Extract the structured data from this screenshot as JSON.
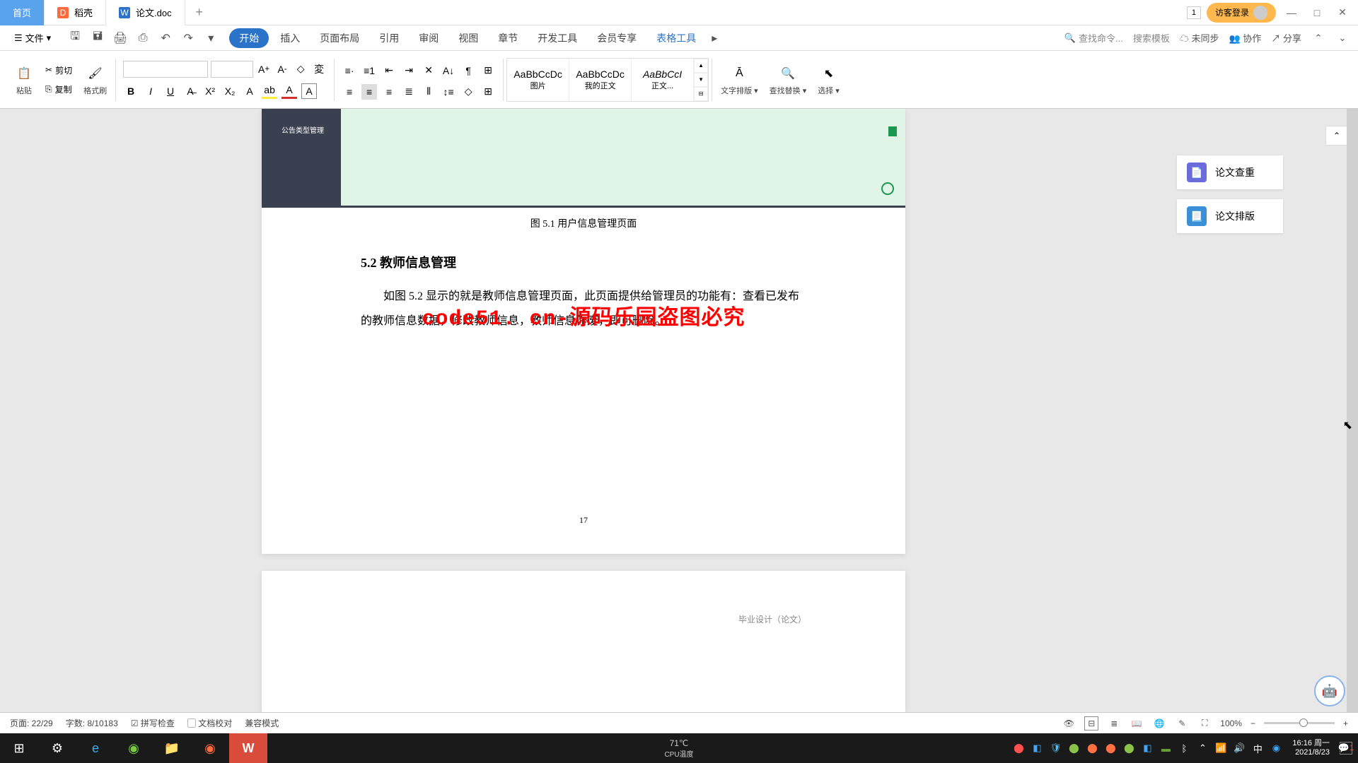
{
  "tabs": {
    "home": "首页",
    "daoke": "稻壳",
    "doc": "论文.doc"
  },
  "title_right": {
    "badge": "1",
    "login": "访客登录"
  },
  "menu": {
    "file": "文件",
    "items": [
      "开始",
      "插入",
      "页面布局",
      "引用",
      "审阅",
      "视图",
      "章节",
      "开发工具",
      "会员专享",
      "表格工具"
    ],
    "search_cmd": "查找命令...",
    "search_tpl": "搜索模板",
    "unsync": "未同步",
    "coop": "协作",
    "share": "分享"
  },
  "ribbon": {
    "paste": "粘贴",
    "cut": "剪切",
    "copy": "复制",
    "format_painter": "格式刷",
    "styles": {
      "s1_preview": "AaBbCcDc",
      "s1_name": "图片",
      "s2_preview": "AaBbCcDc",
      "s2_name": "我的正文",
      "s3_preview": "AaBbCcI",
      "s3_name": "正文..."
    },
    "text_layout": "文字排版",
    "find_replace": "查找替换",
    "select": "选择"
  },
  "document": {
    "embedded_label": "公告类型管理",
    "fig_caption": "图 5.1  用户信息管理页面",
    "heading": "5.2  教师信息管理",
    "paragraph": "如图 5.2 显示的就是教师信息管理页面，此页面提供给管理员的功能有：查看已发布的教师信息数据，修改教师信息，教师信息作废，即可删除。",
    "page_num": "17",
    "page2_header": "毕业设计（论文）",
    "watermark_center": "code51. cn-源码乐园盗图必究",
    "watermark_tile": "code51.cn"
  },
  "side": {
    "check": "论文查重",
    "layout": "论文排版"
  },
  "status": {
    "page": "页面: 22/29",
    "words": "字数: 8/10183",
    "spell": "拼写检查",
    "proof": "文档校对",
    "compat": "兼容模式",
    "zoom": "100%"
  },
  "taskbar": {
    "cpu_temp": "71℃",
    "cpu_label": "CPU温度",
    "time": "16:16 周一",
    "date": "2021/8/23",
    "ime": "中"
  }
}
